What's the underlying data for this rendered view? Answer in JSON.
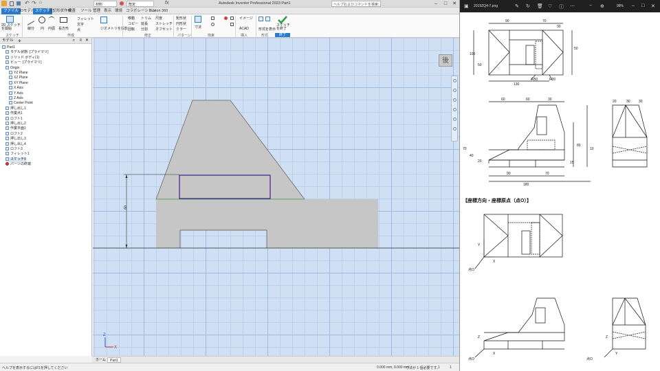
{
  "inventor": {
    "title": "Autodesk Inventor Professional 2023  Part1",
    "search_placeholder": "ヘルプおよびコマンドを検索...",
    "qa_combo": "既定",
    "qa_mode": "材料",
    "tabs": [
      "ファイル",
      "3Dモデル",
      "スケッチ",
      "注記形状作成",
      "検査",
      "ツール",
      "管理",
      "表示",
      "環境",
      "コラボレーション",
      "Fusion 360"
    ],
    "active_tab_index": 2,
    "ribbon": {
      "create_2d_sketch": "2D スケッチを開始",
      "line": "線分",
      "circle": "円",
      "arc": "円弧",
      "rectangle": "長方形",
      "fillet": "フィレット",
      "text": "文字",
      "point": "点",
      "project_geometry": "ジオメトリを投影",
      "move": "移動",
      "trim": "トリム",
      "scale": "尺度",
      "copy": "コピー",
      "extend": "延長",
      "stretch": "ストレッチ",
      "rotate": "回転",
      "split": "分割",
      "offset": "オフセット",
      "rect_pattern": "矩形状",
      "circ_pattern": "円形状",
      "mirror": "ミラー",
      "dimension": "寸法",
      "image": "イメージ",
      "acad": "ACAD",
      "show_format": "形式を表示",
      "finish_sketch": "スケッチを終了",
      "panels": {
        "sketch": "スケッチ",
        "create": "作成",
        "modify": "修正",
        "pattern": "パターン",
        "constrain": "拘束",
        "insert": "挿入",
        "format": "形式",
        "exit": "終了"
      }
    },
    "browser": {
      "header": "モデル",
      "items": [
        {
          "label": "Part1",
          "indent": 0
        },
        {
          "label": "モデル状態: [プライマリ]",
          "indent": 1
        },
        {
          "label": "ソリッド ボディ(1)",
          "indent": 1
        },
        {
          "label": "ビュー: [プライマリ]",
          "indent": 1
        },
        {
          "label": "Origin",
          "indent": 1
        },
        {
          "label": "YZ Plane",
          "indent": 2
        },
        {
          "label": "XZ Plane",
          "indent": 2
        },
        {
          "label": "XY Plane",
          "indent": 2
        },
        {
          "label": "X Axis",
          "indent": 2
        },
        {
          "label": "Y Axis",
          "indent": 2
        },
        {
          "label": "Z Axis",
          "indent": 2
        },
        {
          "label": "Center Point",
          "indent": 2
        },
        {
          "label": "押し出し1",
          "indent": 1
        },
        {
          "label": "作業点1",
          "indent": 1
        },
        {
          "label": "ロフト1",
          "indent": 1
        },
        {
          "label": "押し出し2",
          "indent": 1
        },
        {
          "label": "作業平面1",
          "indent": 1
        },
        {
          "label": "ロフト2",
          "indent": 1
        },
        {
          "label": "押し出し3",
          "indent": 1
        },
        {
          "label": "押し出し4",
          "indent": 1
        },
        {
          "label": "ロフト3",
          "indent": 1
        },
        {
          "label": "フィレット1",
          "indent": 1
        },
        {
          "label": "スケッチ9",
          "indent": 1
        },
        {
          "label": "パーツの終端",
          "indent": 1
        }
      ],
      "selected_index": 22
    },
    "dimension_value": "60",
    "doc_tabs": [
      "ホーム",
      "Part1"
    ],
    "active_doc_tab": 1,
    "status_left": "ヘルプを表示するにはF1を押してください",
    "status_coords": "0.000 mm, 0.000 mm",
    "status_dims": "寸法が 1 個必要です。",
    "status_num1": "1",
    "status_num2": "1"
  },
  "viewer": {
    "filename": "2019ZQ4-7.png",
    "zoom": "98%",
    "section_title": "【座標方向・座標原点（点O）】",
    "dims": {
      "d90": "90",
      "d70": "70",
      "d30": "30",
      "d100": "100",
      "d50": "50",
      "d130": "130",
      "r50": "R50",
      "r20": "R20",
      "d60": "60",
      "d40": "40",
      "d80": "80",
      "d15": "15",
      "d180": "180",
      "d20": "20",
      "d10": "10"
    },
    "labels": {
      "point_o": "点O",
      "x": "X",
      "y": "Y",
      "z": "Z"
    }
  }
}
